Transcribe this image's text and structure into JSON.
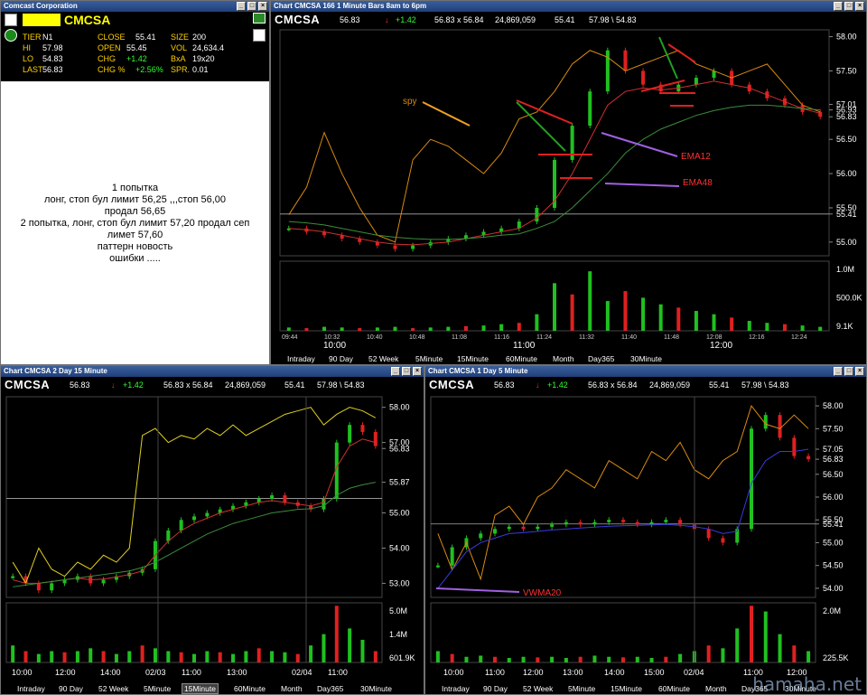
{
  "quote": {
    "window_title": "Comcast Corporation",
    "symbol": "CMCSA",
    "rows": [
      {
        "l": "TIER",
        "v": "N1"
      },
      {
        "l": "CLOSE",
        "v": "55.41"
      },
      {
        "l": "SIZE",
        "v": "200"
      },
      {
        "l": "HI",
        "v": "57.98"
      },
      {
        "l": "OPEN",
        "v": "55.45"
      },
      {
        "l": "VOL",
        "v": "24,634.4"
      },
      {
        "l": "LO",
        "v": "54.83"
      },
      {
        "l": "CHG",
        "v": "+1.42"
      },
      {
        "l": "BxA",
        "v": "19x20"
      },
      {
        "l": "LAST",
        "v": "56.83"
      },
      {
        "l": "CHG %",
        "v": "+2.56%"
      },
      {
        "l": "SPR.",
        "v": "0.01"
      }
    ]
  },
  "notes": {
    "lines": [
      "1 попытка",
      "лонг, стоп бул лимит  56,25 ,,,стоп 56,00",
      "продал 56,65",
      "2 попытка, лонг, стоп бул лимит 57,20 продал сеп",
      "лимет 57,60",
      "паттерн новость",
      "ошибки ....."
    ]
  },
  "header_common": {
    "symbol": "CMCSA",
    "last": "56.83",
    "arrow": "↓",
    "chg": "+1.42",
    "bidask": "56.83 x 56.84",
    "volume": "24,869,059",
    "close": "55.41",
    "range": "57.98 \\ 54.83"
  },
  "tabs": [
    "Intraday",
    "90 Day",
    "52 Week",
    "5Minute",
    "15Minute",
    "60Minute",
    "Month",
    "Day365",
    "30Minute"
  ],
  "chart_main": {
    "title": "Chart CMCSA 166 1 Minute Bars 8am to 6pm",
    "ylabels": [
      "58.00",
      "57.50",
      "57.01",
      "56.93",
      "56.83",
      "56.50",
      "56.00",
      "55.50",
      "55.41",
      "55.00"
    ],
    "vol_labels": [
      "1.0M",
      "500.0K",
      "9.1K"
    ],
    "xlabels_small": [
      "09:44",
      "10:32",
      "10:40",
      "10:48",
      "11:08",
      "11:16",
      "11:24",
      "11:32",
      "11:40",
      "11:48",
      "12:08",
      "12:16",
      "12:24"
    ],
    "xlabels_big": [
      "10:00",
      "11:00",
      "12:00"
    ],
    "annotations": [
      "spy",
      "EMA12",
      "EMA48"
    ],
    "chart_data": {
      "type": "line",
      "series": [
        {
          "name": "price",
          "values": [
            55.2,
            55.15,
            55.1,
            55.05,
            55.0,
            54.95,
            54.9,
            54.95,
            55.0,
            55.05,
            55.1,
            55.15,
            55.2,
            55.3,
            55.5,
            56.2,
            56.7,
            57.2,
            57.8,
            57.5,
            57.3,
            57.2,
            57.3,
            57.4,
            57.5,
            57.3,
            57.2,
            57.1,
            57.0,
            56.9,
            56.83
          ]
        },
        {
          "name": "spy",
          "values": [
            55.4,
            55.8,
            56.6,
            56.0,
            55.5,
            55.1,
            55.0,
            56.2,
            56.5,
            56.4,
            56.2,
            56.0,
            56.3,
            56.8,
            56.9,
            57.2,
            57.6,
            57.8,
            57.7,
            57.5,
            57.6,
            57.7,
            57.8,
            57.6,
            57.5,
            57.4,
            57.5,
            57.6,
            57.3,
            57.0,
            56.9
          ]
        },
        {
          "name": "EMA12",
          "values": [
            55.2,
            55.18,
            55.15,
            55.1,
            55.05,
            55.0,
            54.97,
            54.96,
            54.98,
            55.0,
            55.05,
            55.1,
            55.15,
            55.2,
            55.35,
            55.6,
            56.0,
            56.5,
            57.0,
            57.2,
            57.25,
            57.22,
            57.25,
            57.3,
            57.35,
            57.3,
            57.25,
            57.15,
            57.05,
            56.95,
            56.88
          ]
        },
        {
          "name": "EMA48",
          "values": [
            55.3,
            55.28,
            55.25,
            55.2,
            55.15,
            55.1,
            55.07,
            55.05,
            55.04,
            55.04,
            55.05,
            55.07,
            55.1,
            55.12,
            55.2,
            55.3,
            55.5,
            55.75,
            56.0,
            56.3,
            56.5,
            56.65,
            56.75,
            56.85,
            56.92,
            56.97,
            57.0,
            57.0,
            56.98,
            56.95,
            56.93
          ]
        }
      ],
      "volume": [
        0.05,
        0.04,
        0.06,
        0.05,
        0.04,
        0.05,
        0.06,
        0.04,
        0.05,
        0.06,
        0.07,
        0.08,
        0.1,
        0.12,
        0.25,
        0.72,
        0.55,
        0.9,
        0.45,
        0.6,
        0.5,
        0.4,
        0.35,
        0.3,
        0.25,
        0.2,
        0.15,
        0.12,
        0.1,
        0.08,
        0.06
      ],
      "ylim": [
        54.8,
        58.1
      ]
    }
  },
  "chart_2day": {
    "title": "Chart CMCSA 2 Day 15 Minute",
    "ylabels": [
      "58.00",
      "57.00",
      "56.83",
      "55.87",
      "55.00",
      "54.00",
      "53.00"
    ],
    "vol_labels": [
      "5.0M",
      "1.4M",
      "601.9K"
    ],
    "xlabels": [
      "10:00",
      "12:00",
      "14:00",
      "02/03",
      "11:00",
      "13:00",
      "02/04",
      "11:00"
    ],
    "chart_data": {
      "type": "line",
      "series": [
        {
          "name": "price",
          "values": [
            53.2,
            53.0,
            52.8,
            53.0,
            53.1,
            53.2,
            53.0,
            53.1,
            53.2,
            53.3,
            53.4,
            54.2,
            54.5,
            54.8,
            54.9,
            55.0,
            55.1,
            55.2,
            55.3,
            55.4,
            55.5,
            55.3,
            55.2,
            55.1,
            55.4,
            57.0,
            57.5,
            57.3,
            56.9
          ]
        },
        {
          "name": "spy",
          "values": [
            53.6,
            53.0,
            54.0,
            53.4,
            53.2,
            53.6,
            53.4,
            53.8,
            53.6,
            54.0,
            57.2,
            57.4,
            57.0,
            57.2,
            57.1,
            57.4,
            57.2,
            57.5,
            57.2,
            57.4,
            57.6,
            57.8,
            57.9,
            58.0,
            57.5,
            57.8,
            58.0,
            57.9,
            57.7
          ]
        },
        {
          "name": "ma1",
          "values": [
            53.1,
            53.0,
            53.0,
            53.05,
            53.1,
            53.15,
            53.1,
            53.12,
            53.18,
            53.25,
            53.35,
            53.8,
            54.2,
            54.5,
            54.7,
            54.85,
            55.0,
            55.1,
            55.2,
            55.3,
            55.35,
            55.3,
            55.25,
            55.2,
            55.3,
            56.3,
            56.9,
            57.1,
            57.0
          ]
        },
        {
          "name": "ma2",
          "values": [
            52.9,
            52.95,
            53.0,
            53.05,
            53.1,
            53.15,
            53.2,
            53.25,
            53.3,
            53.35,
            53.45,
            53.6,
            53.8,
            54.0,
            54.2,
            54.4,
            54.55,
            54.7,
            54.8,
            54.9,
            55.0,
            55.05,
            55.1,
            55.12,
            55.2,
            55.5,
            55.7,
            55.8,
            55.87
          ]
        }
      ],
      "volume": [
        0.3,
        0.2,
        0.15,
        0.2,
        0.18,
        0.2,
        0.25,
        0.2,
        0.15,
        0.2,
        0.3,
        0.25,
        0.2,
        0.18,
        0.15,
        0.2,
        0.18,
        0.15,
        0.2,
        0.25,
        0.2,
        0.18,
        0.15,
        0.3,
        0.5,
        1.0,
        0.6,
        0.4,
        0.2
      ],
      "ylim": [
        52.6,
        58.3
      ]
    }
  },
  "chart_1day": {
    "title": "Chart CMCSA 1 Day 5 Minute",
    "ylabels": [
      "58.00",
      "57.50",
      "57.05",
      "56.83",
      "56.50",
      "56.00",
      "55.50",
      "55.41",
      "55.00",
      "54.50",
      "54.00"
    ],
    "vol_labels": [
      "2.0M",
      "225.5K"
    ],
    "xlabels": [
      "10:00",
      "11:00",
      "12:00",
      "13:00",
      "14:00",
      "15:00",
      "02/04",
      "11:00",
      "12:00"
    ],
    "annotations": [
      "VWMA20"
    ],
    "chart_data": {
      "type": "line",
      "series": [
        {
          "name": "price",
          "values": [
            54.5,
            54.9,
            55.1,
            55.2,
            55.3,
            55.35,
            55.3,
            55.35,
            55.4,
            55.45,
            55.4,
            55.45,
            55.5,
            55.45,
            55.4,
            55.45,
            55.5,
            55.4,
            55.3,
            55.1,
            55.0,
            55.3,
            57.5,
            57.8,
            57.3,
            56.9,
            56.83
          ]
        },
        {
          "name": "spy",
          "values": [
            55.2,
            54.4,
            55.0,
            54.2,
            55.6,
            55.8,
            55.4,
            56.0,
            56.2,
            56.6,
            56.4,
            56.2,
            56.8,
            56.6,
            56.4,
            57.0,
            56.8,
            57.2,
            56.6,
            56.4,
            56.8,
            57.0,
            58.0,
            57.6,
            57.5,
            57.8,
            57.5
          ]
        },
        {
          "name": "VWMA20",
          "values": [
            54.0,
            54.4,
            54.8,
            55.0,
            55.1,
            55.2,
            55.22,
            55.25,
            55.28,
            55.3,
            55.32,
            55.34,
            55.36,
            55.37,
            55.38,
            55.39,
            55.4,
            55.38,
            55.35,
            55.3,
            55.2,
            55.25,
            56.3,
            56.8,
            57.0,
            57.0,
            57.05
          ]
        }
      ],
      "volume": [
        0.2,
        0.15,
        0.1,
        0.12,
        0.1,
        0.08,
        0.1,
        0.09,
        0.1,
        0.08,
        0.1,
        0.12,
        0.1,
        0.09,
        0.1,
        0.08,
        0.1,
        0.15,
        0.2,
        0.3,
        0.25,
        0.6,
        1.0,
        0.9,
        0.5,
        0.3,
        0.2
      ],
      "ylim": [
        53.8,
        58.2
      ]
    }
  },
  "watermark": "hamaha.net"
}
